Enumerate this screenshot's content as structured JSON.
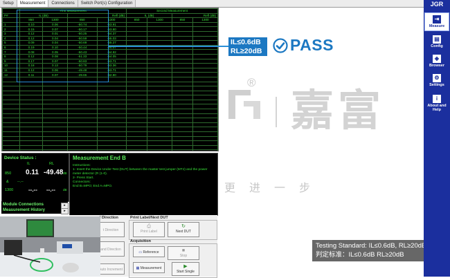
{
  "tabs": [
    "Setup",
    "Measurement",
    "Connections",
    "Switch Port(s) Configuration"
  ],
  "grid": {
    "group_headers": [
      "First Measurement",
      "Second Measurement"
    ],
    "subheaders": [
      "IL (dB)",
      "Refl (dB)",
      "IL (dB)",
      "Refl (dB)"
    ],
    "index_label": "P#",
    "wavelengths": [
      "850",
      "1300",
      "850",
      "1300",
      "850",
      "1300",
      "850",
      "1300"
    ],
    "rows": [
      [
        "1",
        "0.10",
        "0.06",
        "-50.74",
        "-53.91"
      ],
      [
        "2",
        "0.15",
        "0.07",
        "-50.17",
        "-53.80"
      ],
      [
        "3",
        "0.12",
        "0.01",
        "-50.25",
        "-54.37"
      ],
      [
        "4",
        "0.12",
        "0.04",
        "-50.59",
        "-55.03"
      ],
      [
        "5",
        "0.09",
        "0.04",
        "-50.69",
        "-55.27"
      ],
      [
        "6",
        "0.19",
        "0.10",
        "-50.44",
        "-54.07"
      ],
      [
        "7",
        "0.08",
        "0.05",
        "-50.43",
        "-54.92"
      ],
      [
        "8",
        "0.12",
        "0.08",
        "-51.33",
        "-54.05"
      ],
      [
        "9",
        "0.17",
        "0.07",
        "-50.83",
        "-53.71"
      ],
      [
        "10",
        "0.18",
        "0.13",
        "-50.79",
        "-53.36"
      ],
      [
        "11",
        "0.12",
        "0.06",
        "-49.48",
        "-53.71"
      ],
      [
        "12",
        "0.11",
        "0.07",
        "-49.65",
        "-52.80"
      ]
    ]
  },
  "annotation": {
    "spec_line1": "IL≤0.6dB",
    "spec_line2": "RL≥20dB",
    "pass": "PASS",
    "color": "#1c78c2"
  },
  "watermark": {
    "reg": "®",
    "big": "嘉富",
    "slogan": "更进一步"
  },
  "device_status": {
    "title": "Device Status :",
    "col_il": "IL",
    "col_rl": "RL",
    "row1_label": "850",
    "row1_il": "0.11",
    "row1_rl": "-49.48",
    "row1_unit": "dB",
    "row_amp": "&",
    "mid_values": "--.--",
    "row2_label": "1300",
    "row2_il": "--.--",
    "row2_rl": "--.--",
    "row2_unit": "dB"
  },
  "measure": {
    "title": "Measurement End B",
    "instructions": "Instructions:",
    "line1": "1- Insert the Device Under Test (DUT) between the master test jumper (MTJ) and the power meter detector (R (1-0).",
    "line2": "2- Press Start.",
    "connectors": "Connectors:",
    "line3": "End B=MPO; End A=MPO."
  },
  "links": {
    "module_connections": "Module Connections",
    "measurement_history": "Measurement History",
    "arrow": "▸"
  },
  "lower": {
    "direction_group": "l Direction",
    "print_group": "Print Label/Next DUT",
    "acquisition_group": "Acquisition",
    "print_label": "Print Label",
    "next_dut": "Next DUT",
    "direction_btn1": "t Direction",
    "direction_btn2": "and Direction",
    "reference": "Reference",
    "stop": "Stop",
    "auto_increment": "Auto Increment",
    "measurement": "Measurement",
    "start_single": "Start Single"
  },
  "standard": {
    "line1": "Testing Standard: IL≤0.6dB, RL≥20dB",
    "line2": "判定标准：IL≤0.6dB  RL≥20dB"
  },
  "sidebar": {
    "logo": "JGR",
    "items": [
      {
        "label": "Measure",
        "icon": "⇥"
      },
      {
        "label": "Config",
        "icon": "▤"
      },
      {
        "label": "Browser",
        "icon": "◈"
      },
      {
        "label": "Settings",
        "icon": "⚙"
      },
      {
        "label": "About and Help",
        "icon": "i"
      }
    ]
  }
}
